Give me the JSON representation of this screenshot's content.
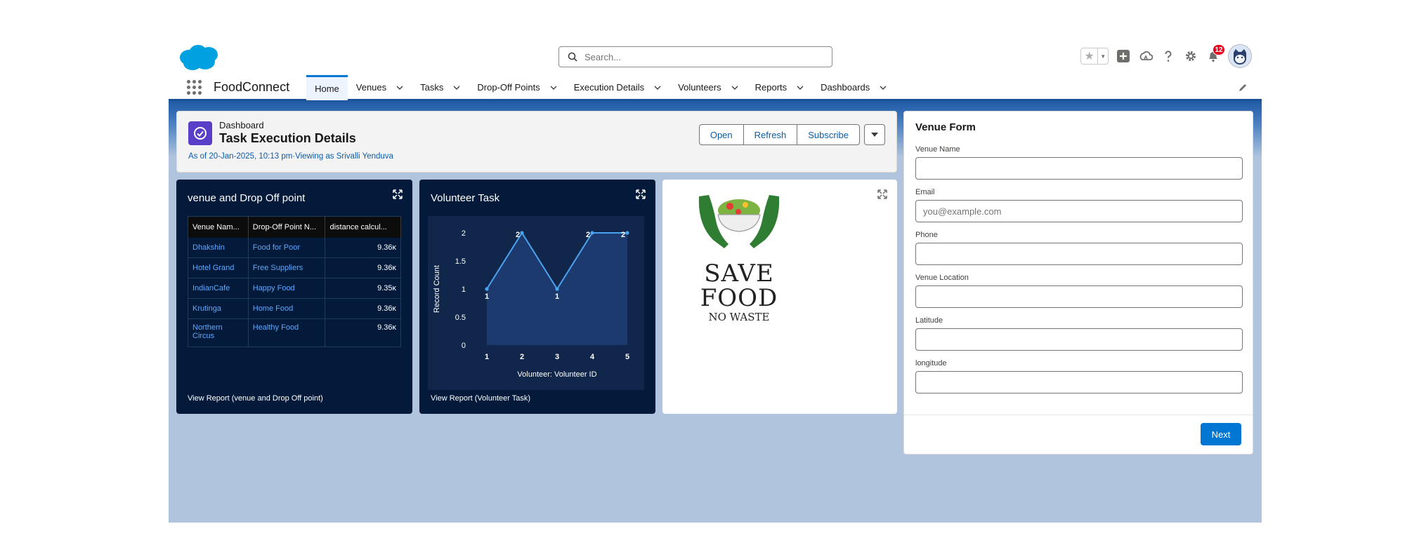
{
  "colors": {
    "brand": "#0176d3",
    "dashboard_dark": "#031a3a",
    "link": "#0b5cab",
    "notification": "#ea001e"
  },
  "header": {
    "search_placeholder": "Search...",
    "notifications_count": "12",
    "icons": [
      "salesforce-cloud-logo",
      "favorites-star-icon",
      "add-icon",
      "trailhead-icon",
      "help-icon",
      "setup-gear-icon",
      "notifications-bell-icon",
      "user-avatar"
    ]
  },
  "nav": {
    "app_name": "FoodConnect",
    "tabs": [
      {
        "label": "Home",
        "active": true,
        "has_menu": false
      },
      {
        "label": "Venues",
        "has_menu": true
      },
      {
        "label": "Tasks",
        "has_menu": true
      },
      {
        "label": "Drop-Off Points",
        "has_menu": true
      },
      {
        "label": "Execution Details",
        "has_menu": true
      },
      {
        "label": "Volunteers",
        "has_menu": true
      },
      {
        "label": "Reports",
        "has_menu": true
      },
      {
        "label": "Dashboards",
        "has_menu": true
      }
    ]
  },
  "dashboard": {
    "kicker": "Dashboard",
    "title": "Task Execution Details",
    "subtitle": "As of 20-Jan-2025, 10:13 pm·Viewing as Srivalli Yenduva",
    "buttons": {
      "open": "Open",
      "refresh": "Refresh",
      "subscribe": "Subscribe"
    }
  },
  "widget_table": {
    "title": "venue and Drop Off point",
    "columns": [
      "Venue Nam...",
      "Drop-Off Point N...",
      "distance calcul..."
    ],
    "rows": [
      [
        "Dhakshin",
        "Food for Poor",
        "9.36ᴋ"
      ],
      [
        "Hotel Grand",
        "Free Suppliers",
        "9.36ᴋ"
      ],
      [
        "IndianCafe",
        "Happy Food",
        "9.35ᴋ"
      ],
      [
        "Krutinga",
        "Home Food",
        "9.36ᴋ"
      ],
      [
        "Northern Circus",
        "Healthy Food",
        "9.36ᴋ"
      ]
    ],
    "footer": "View Report (venue and Drop Off point)"
  },
  "widget_chart": {
    "title": "Volunteer Task",
    "footer": "View Report (Volunteer Task)"
  },
  "chart_data": {
    "type": "area",
    "x": [
      "1",
      "2",
      "3",
      "4",
      "5"
    ],
    "series": [
      {
        "values": [
          1,
          2,
          1,
          2,
          2
        ]
      }
    ],
    "xlabel": "Volunteer: Volunteer ID",
    "ylabel": "Record Count",
    "yticks": [
      "0",
      "0.5",
      "1",
      "1.5",
      "2"
    ],
    "ylim": [
      0,
      2
    ],
    "data_labels": true,
    "grid": false
  },
  "widget_logo": {
    "logo_text_1": "SAVE",
    "logo_text_2": "FOOD",
    "logo_text_3": "NO WASTE"
  },
  "venue_form": {
    "title": "Venue Form",
    "fields": [
      {
        "label": "Venue Name",
        "value": "",
        "placeholder": ""
      },
      {
        "label": "Email",
        "value": "",
        "placeholder": "you@example.com"
      },
      {
        "label": "Phone",
        "value": "",
        "placeholder": ""
      },
      {
        "label": "Venue Location",
        "value": "",
        "placeholder": ""
      },
      {
        "label": "Latitude",
        "value": "",
        "placeholder": ""
      },
      {
        "label": "longitude",
        "value": "",
        "placeholder": ""
      }
    ],
    "next_label": "Next"
  }
}
